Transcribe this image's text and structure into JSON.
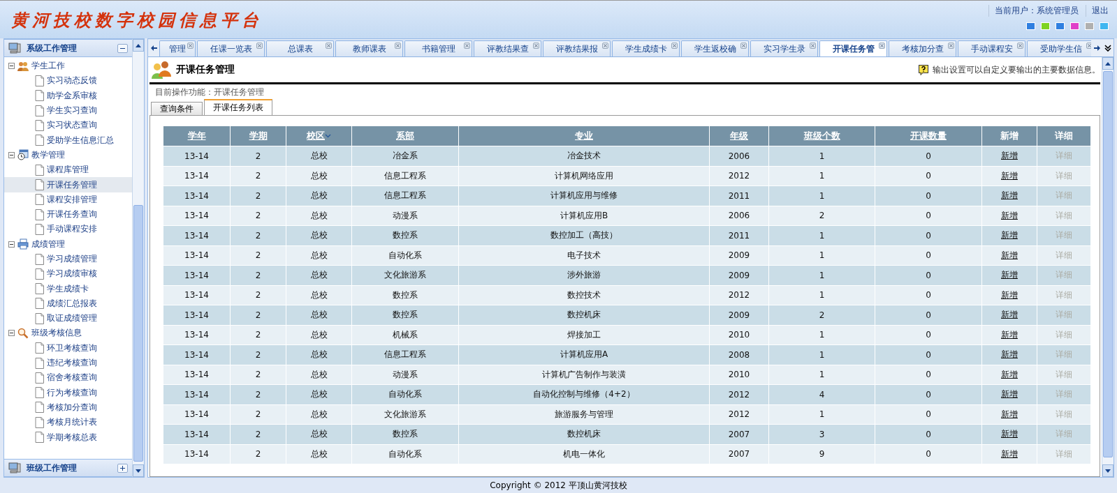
{
  "header": {
    "title": "黄河技校数字校园信息平台",
    "user": "当前用户：系统管理员",
    "logout": "退出",
    "themes": [
      {
        "color": "#2f7fe0"
      },
      {
        "color": "#7ed321"
      },
      {
        "color": "#2f7fe0"
      },
      {
        "color": "#e040c8"
      },
      {
        "color": "#b0b0b0"
      },
      {
        "color": "#3fb6f0"
      }
    ]
  },
  "sidebar": {
    "groups": [
      {
        "title": "系级工作管理",
        "expanded": true,
        "children": [
          {
            "label": "学生工作",
            "expanded": true,
            "children": [
              {
                "label": "实习动态反馈",
                "selected": false
              },
              {
                "label": "助学金系审核",
                "selected": false
              },
              {
                "label": "学生实习查询",
                "selected": false
              },
              {
                "label": "实习状态查询",
                "selected": false
              },
              {
                "label": "受助学生信息汇总",
                "selected": false
              }
            ]
          },
          {
            "label": "教学管理",
            "expanded": true,
            "children": [
              {
                "label": "课程库管理",
                "selected": false
              },
              {
                "label": "开课任务管理",
                "selected": true
              },
              {
                "label": "课程安排管理",
                "selected": false
              },
              {
                "label": "开课任务查询",
                "selected": false
              },
              {
                "label": "手动课程安排",
                "selected": false
              }
            ]
          },
          {
            "label": "成绩管理",
            "expanded": true,
            "children": [
              {
                "label": "学习成绩管理",
                "selected": false
              },
              {
                "label": "学习成绩审核",
                "selected": false
              },
              {
                "label": "学生成绩卡",
                "selected": false
              },
              {
                "label": "成绩汇总报表",
                "selected": false
              },
              {
                "label": "取证成绩管理",
                "selected": false
              }
            ]
          },
          {
            "label": "班级考核信息",
            "expanded": true,
            "children": [
              {
                "label": "环卫考核查询",
                "selected": false
              },
              {
                "label": "违纪考核查询",
                "selected": false
              },
              {
                "label": "宿舍考核查询",
                "selected": false
              },
              {
                "label": "行为考核查询",
                "selected": false
              },
              {
                "label": "考核加分查询",
                "selected": false
              },
              {
                "label": "考核月统计表",
                "selected": false
              },
              {
                "label": "学期考核总表",
                "selected": false
              }
            ]
          }
        ]
      },
      {
        "title": "班级工作管理",
        "expanded": false
      }
    ]
  },
  "tabs": [
    {
      "label": "管理",
      "selected": false
    },
    {
      "label": "任课一览表",
      "selected": false
    },
    {
      "label": "总课表",
      "selected": false
    },
    {
      "label": "教师课表",
      "selected": false
    },
    {
      "label": "书籍管理",
      "selected": false
    },
    {
      "label": "评教结果查",
      "selected": false
    },
    {
      "label": "评教结果报",
      "selected": false
    },
    {
      "label": "学生成绩卡",
      "selected": false
    },
    {
      "label": "学生返校确",
      "selected": false
    },
    {
      "label": "实习学生录",
      "selected": false
    },
    {
      "label": "开课任务管",
      "selected": true
    },
    {
      "label": "考核加分查",
      "selected": false
    },
    {
      "label": "手动课程安",
      "selected": false
    },
    {
      "label": "受助学生信",
      "selected": false
    }
  ],
  "page": {
    "title": "开课任务管理",
    "help": "输出设置可以自定义要输出的主要数据信息。",
    "breadcrumb": "目前操作功能：开课任务管理",
    "subtabs": [
      {
        "label": "查询条件",
        "selected": false
      },
      {
        "label": "开课任务列表",
        "selected": true
      }
    ],
    "table": {
      "columns": [
        {
          "label": "学年",
          "kind": "link",
          "sorted": false
        },
        {
          "label": "学期",
          "kind": "link",
          "sorted": false
        },
        {
          "label": "校区",
          "kind": "link",
          "sorted": true
        },
        {
          "label": "系部",
          "kind": "link",
          "sorted": false
        },
        {
          "label": "专业",
          "kind": "link",
          "sorted": false
        },
        {
          "label": "年级",
          "kind": "link",
          "sorted": false
        },
        {
          "label": "班级个数",
          "kind": "link",
          "sorted": false
        },
        {
          "label": "开课数量",
          "kind": "link",
          "sorted": false
        },
        {
          "label": "新增",
          "kind": "plain",
          "sorted": false
        },
        {
          "label": "详细",
          "kind": "plain",
          "sorted": false
        }
      ],
      "rows": [
        {
          "cells": [
            "13-14",
            "2",
            "总校",
            "冶金系",
            "冶金技术",
            "2006",
            "1",
            "0"
          ],
          "add": "新增",
          "detail": "详细",
          "detail_disabled": true
        },
        {
          "cells": [
            "13-14",
            "2",
            "总校",
            "信息工程系",
            "计算机网络应用",
            "2012",
            "1",
            "0"
          ],
          "add": "新增",
          "detail": "详细",
          "detail_disabled": true
        },
        {
          "cells": [
            "13-14",
            "2",
            "总校",
            "信息工程系",
            "计算机应用与维修",
            "2011",
            "1",
            "0"
          ],
          "add": "新增",
          "detail": "详细",
          "detail_disabled": true
        },
        {
          "cells": [
            "13-14",
            "2",
            "总校",
            "动漫系",
            "计算机应用B",
            "2006",
            "2",
            "0"
          ],
          "add": "新增",
          "detail": "详细",
          "detail_disabled": true
        },
        {
          "cells": [
            "13-14",
            "2",
            "总校",
            "数控系",
            "数控加工（高技）",
            "2011",
            "1",
            "0"
          ],
          "add": "新增",
          "detail": "详细",
          "detail_disabled": true
        },
        {
          "cells": [
            "13-14",
            "2",
            "总校",
            "自动化系",
            "电子技术",
            "2009",
            "1",
            "0"
          ],
          "add": "新增",
          "detail": "详细",
          "detail_disabled": true
        },
        {
          "cells": [
            "13-14",
            "2",
            "总校",
            "文化旅游系",
            "涉外旅游",
            "2009",
            "1",
            "0"
          ],
          "add": "新增",
          "detail": "详细",
          "detail_disabled": true
        },
        {
          "cells": [
            "13-14",
            "2",
            "总校",
            "数控系",
            "数控技术",
            "2012",
            "1",
            "0"
          ],
          "add": "新增",
          "detail": "详细",
          "detail_disabled": true
        },
        {
          "cells": [
            "13-14",
            "2",
            "总校",
            "数控系",
            "数控机床",
            "2009",
            "2",
            "0"
          ],
          "add": "新增",
          "detail": "详细",
          "detail_disabled": true
        },
        {
          "cells": [
            "13-14",
            "2",
            "总校",
            "机械系",
            "焊接加工",
            "2010",
            "1",
            "0"
          ],
          "add": "新增",
          "detail": "详细",
          "detail_disabled": true
        },
        {
          "cells": [
            "13-14",
            "2",
            "总校",
            "信息工程系",
            "计算机应用A",
            "2008",
            "1",
            "0"
          ],
          "add": "新增",
          "detail": "详细",
          "detail_disabled": true
        },
        {
          "cells": [
            "13-14",
            "2",
            "总校",
            "动漫系",
            "计算机广告制作与装潢",
            "2010",
            "1",
            "0"
          ],
          "add": "新增",
          "detail": "详细",
          "detail_disabled": true
        },
        {
          "cells": [
            "13-14",
            "2",
            "总校",
            "自动化系",
            "自动化控制与维修（4+2）",
            "2012",
            "4",
            "0"
          ],
          "add": "新增",
          "detail": "详细",
          "detail_disabled": true
        },
        {
          "cells": [
            "13-14",
            "2",
            "总校",
            "文化旅游系",
            "旅游服务与管理",
            "2012",
            "1",
            "0"
          ],
          "add": "新增",
          "detail": "详细",
          "detail_disabled": true
        },
        {
          "cells": [
            "13-14",
            "2",
            "总校",
            "数控系",
            "数控机床",
            "2007",
            "3",
            "0"
          ],
          "add": "新增",
          "detail": "详细",
          "detail_disabled": true
        },
        {
          "cells": [
            "13-14",
            "2",
            "总校",
            "自动化系",
            "机电一体化",
            "2007",
            "9",
            "0"
          ],
          "add": "新增",
          "detail": "详细",
          "detail_disabled": true
        }
      ]
    }
  },
  "footer": {
    "copyright": "Copyright © 2012 平顶山黄河技校"
  }
}
